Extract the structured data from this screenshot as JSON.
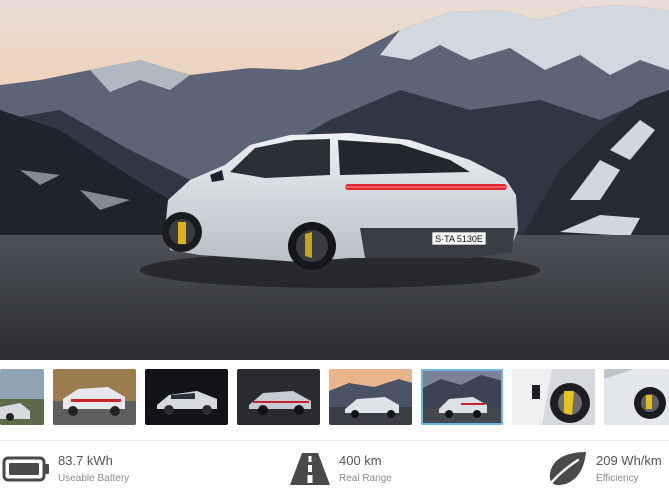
{
  "hero": {
    "image": "porsche-taycan-rear-mountain-sunset",
    "plate_text": "S·TA 5130E"
  },
  "gallery": {
    "selected_index": 5,
    "thumbnails": [
      {
        "subject": "car-front-partial"
      },
      {
        "subject": "car-rear-road"
      },
      {
        "subject": "car-side-dark"
      },
      {
        "subject": "car-side-studio"
      },
      {
        "subject": "car-mountain-sunset"
      },
      {
        "subject": "car-mountain-rear"
      },
      {
        "subject": "wheel-detail-yellow-caliper"
      },
      {
        "subject": "wheel-detail-partial"
      }
    ]
  },
  "specs": [
    {
      "icon": "battery-icon",
      "value": "83.7 kWh",
      "label": "Useable Battery"
    },
    {
      "icon": "road-icon",
      "value": "400 km",
      "label": "Real Range"
    },
    {
      "icon": "leaf-icon",
      "value": "209 Wh/km",
      "label": "Efficiency"
    }
  ],
  "colors": {
    "icon": "#4a4a4a",
    "selected_border": "#6fb7e0",
    "car_body": "#d9dde2",
    "tail_light": "#e0242e"
  }
}
